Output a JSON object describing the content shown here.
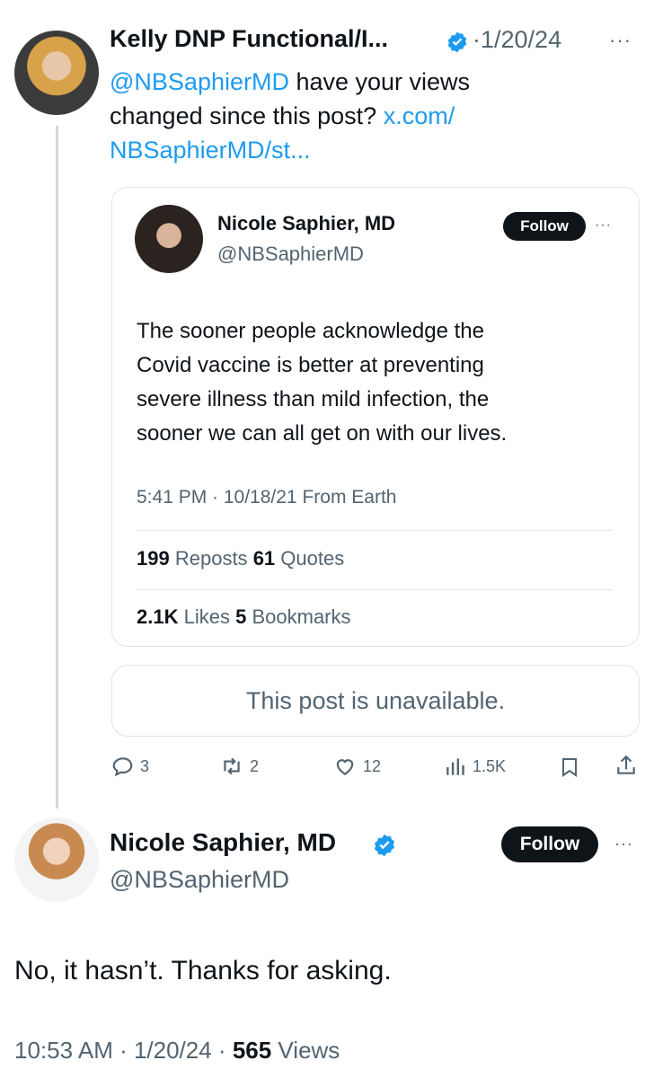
{
  "reply_tweet": {
    "author_name": "Kelly DNP Functional/I...",
    "date": "1/20/24",
    "mention": "@NBSaphierMD",
    "text_part1": " have your views",
    "text_part2": "changed since this post? ",
    "link_part1": "x.com/",
    "link_part2": "NBSaphierMD/st...",
    "more_label": "···"
  },
  "quoted_tweet": {
    "author_name": "Nicole Saphier, MD",
    "handle": "@NBSaphierMD",
    "follow_label": "Follow",
    "text_lines": [
      "The sooner people acknowledge the",
      "Covid vaccine is better at preventing",
      "severe illness than mild infection, the",
      "sooner we can all get on with our lives."
    ],
    "timestamp": "5:41 PM · 10/18/21 From Earth",
    "reposts_count": "199",
    "reposts_label": "Reposts",
    "quotes_count": "61",
    "quotes_label": "Quotes",
    "likes_count": "2.1K",
    "likes_label": "Likes",
    "bookmarks_count": "5",
    "bookmarks_label": "Bookmarks"
  },
  "unavailable_notice": "This post is unavailable.",
  "actions": {
    "replies": "3",
    "reposts": "2",
    "likes": "12",
    "views": "1.5K"
  },
  "main_tweet": {
    "author_name": "Nicole Saphier, MD",
    "handle": "@NBSaphierMD",
    "follow_label": "Follow",
    "text": "No, it hasn’t. Thanks for asking.",
    "time": "10:53 AM · 1/20/24 · ",
    "views_count": "565",
    "views_label": " Views"
  },
  "colors": {
    "accent": "#1d9bf0",
    "text": "#0f1419",
    "muted": "#536471",
    "border": "#dfe3e8",
    "thread_line": "#cfd9de"
  },
  "icons": [
    "verified-badge-icon",
    "reply-icon",
    "repost-icon",
    "like-icon",
    "views-icon",
    "bookmark-icon",
    "share-icon"
  ]
}
